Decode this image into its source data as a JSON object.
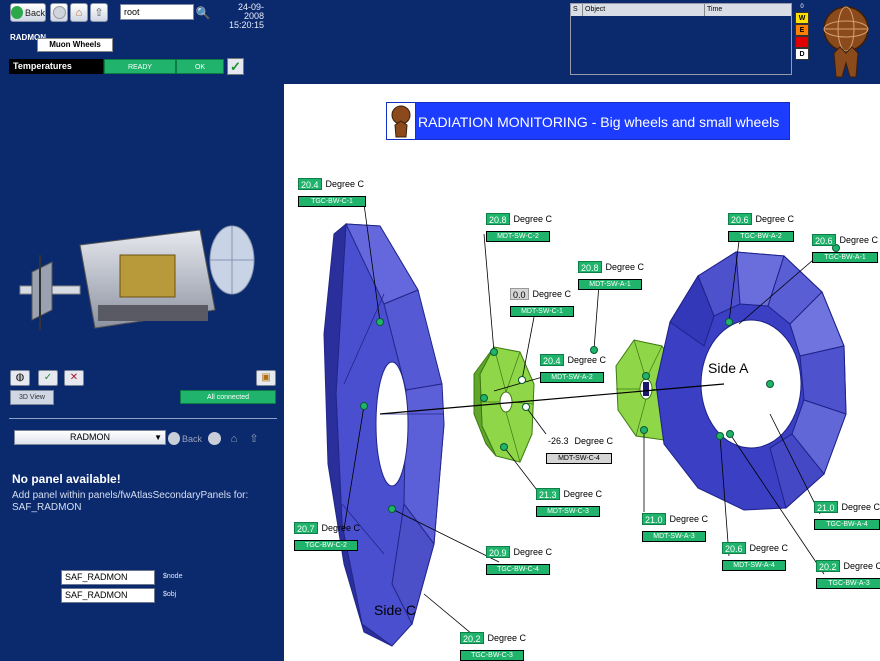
{
  "toolbar": {
    "back_label": "Back",
    "node_value": "root",
    "date": "24-09-2008",
    "time": "15:20:15"
  },
  "tabs": {
    "radmon": "RADMON",
    "muon_wheels": "Muon Wheels"
  },
  "status": {
    "section": "Temperatures",
    "state": "READY",
    "ok": "OK"
  },
  "alarms": {
    "columns": [
      "S",
      "Object",
      "Time"
    ],
    "severities": [
      "0",
      "W",
      "E",
      "",
      "D"
    ]
  },
  "view3d": {
    "button": "3D View",
    "connection": "All connected"
  },
  "secondary": {
    "selected": "RADMON",
    "back_label": "Back",
    "no_panel_title": "No panel available!",
    "no_panel_msg": "Add panel within panels/fwAtlasSecondaryPanels for: SAF_RADMON",
    "node_value": "SAF_RADMON",
    "node_label": "$node",
    "obj_value": "SAF_RADMON",
    "obj_label": "$obj"
  },
  "main": {
    "title": "RADIATION MONITORING - Big wheels and small wheels",
    "side_a": "Side A",
    "side_c": "Side C",
    "unit": "Degree C",
    "sensors": [
      {
        "value": "20.4",
        "name": "TGC-BW-C-1",
        "ok": true
      },
      {
        "value": "20.8",
        "name": "MDT-SW-C-2",
        "ok": true
      },
      {
        "value": "0.0",
        "name": "MDT-SW-C-1",
        "ok": false
      },
      {
        "value": "20.8",
        "name": "MDT-SW-A-1",
        "ok": true
      },
      {
        "value": "20.6",
        "name": "TGC-BW-A-2",
        "ok": true
      },
      {
        "value": "20.6",
        "name": "TGC-BW-A-1",
        "ok": true
      },
      {
        "value": "20.4",
        "name": "MDT-SW-A-2",
        "ok": true
      },
      {
        "value": "-26.3",
        "name": "MDT-SW-C-4",
        "ok": false
      },
      {
        "value": "21.3",
        "name": "MDT-SW-C-3",
        "ok": true
      },
      {
        "value": "21.0",
        "name": "MDT-SW-A-3",
        "ok": true
      },
      {
        "value": "21.0",
        "name": "TGC-BW-A-4",
        "ok": true
      },
      {
        "value": "20.7",
        "name": "TGC-BW-C-2",
        "ok": true
      },
      {
        "value": "20.9",
        "name": "TGC-BW-C-4",
        "ok": true
      },
      {
        "value": "20.6",
        "name": "MDT-SW-A-4",
        "ok": true
      },
      {
        "value": "20.2",
        "name": "TGC-BW-A-3",
        "ok": true
      },
      {
        "value": "20.2",
        "name": "TGC-BW-C-3",
        "ok": true
      }
    ]
  },
  "colors": {
    "background": "#0b2a6e",
    "ok_green": "#1fb36b",
    "title_blue": "#1c3cff",
    "wheel_blue": "#3a3fc4",
    "small_wheel_green": "#8fd648"
  }
}
